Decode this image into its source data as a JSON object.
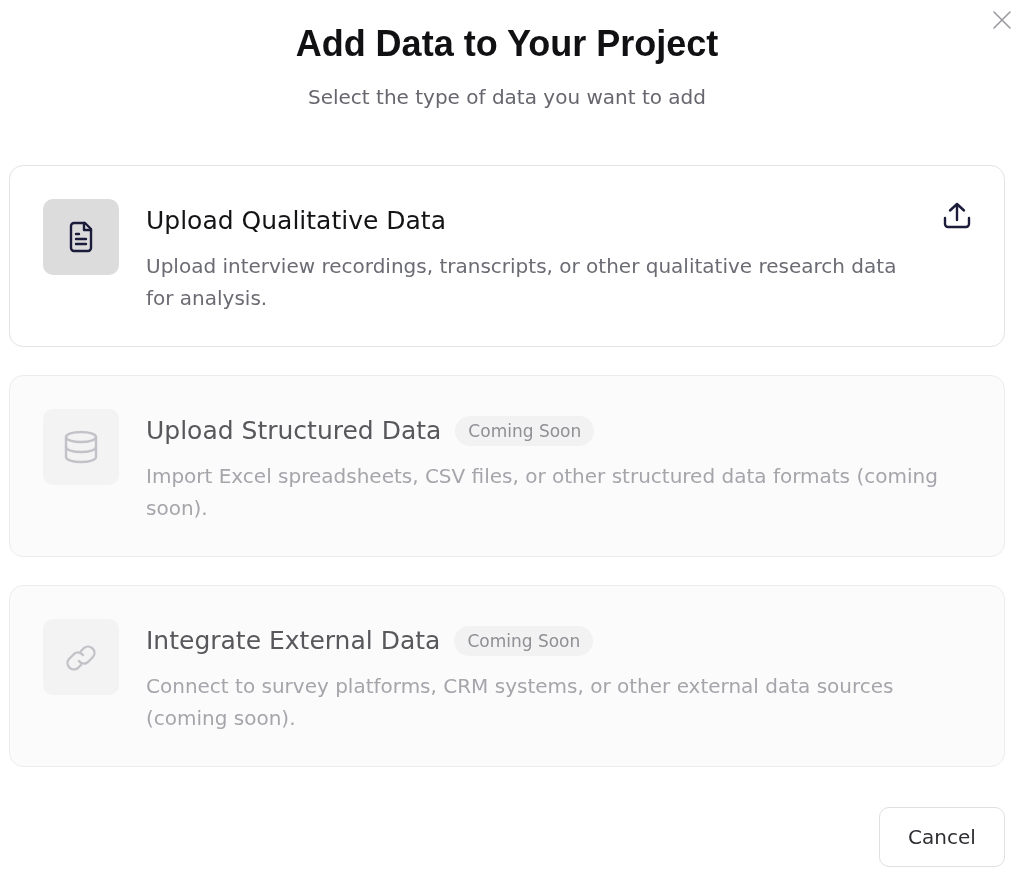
{
  "dialog": {
    "title": "Add Data to Your Project",
    "subtitle": "Select the type of data you want to add"
  },
  "options": [
    {
      "title": "Upload Qualitative Data",
      "description": "Upload interview recordings, transcripts, or other qualitative research data for analysis.",
      "disabled": false
    },
    {
      "title": "Upload Structured Data",
      "badge": "Coming Soon",
      "description": "Import Excel spreadsheets, CSV files, or other structured data formats (coming soon).",
      "disabled": true
    },
    {
      "title": "Integrate External Data",
      "badge": "Coming Soon",
      "description": "Connect to survey platforms, CRM systems, or other external data sources (coming soon).",
      "disabled": true
    }
  ],
  "buttons": [
    {
      "label": "Cancel"
    }
  ]
}
